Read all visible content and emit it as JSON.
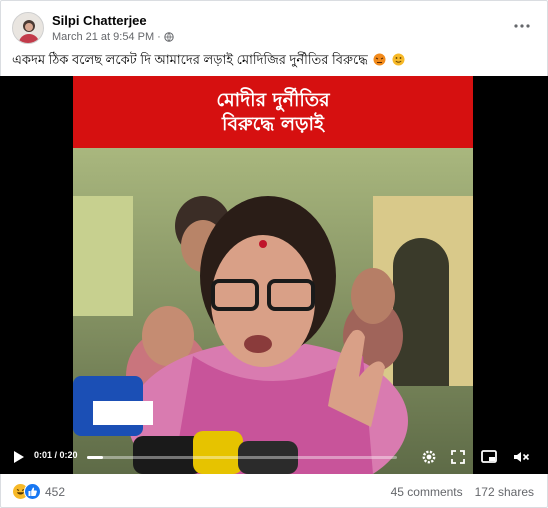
{
  "post": {
    "author": "Silpi Chatterjee",
    "timestamp": "March 21 at 9:54 PM",
    "separator": "·",
    "privacy_icon": "globe-icon",
    "more_icon": "more-options-icon",
    "caption": "একদম ঠিক বলেছ লকেট দি আমাদের লড়াই মোদিজির দুর্নীতির বিরুদ্ধে"
  },
  "video": {
    "banner_line1": "মোদীর দুর্নীতির",
    "banner_line2": "বিরুদ্ধে লড়াই",
    "time": "0:01 / 0:20",
    "progress": 0.05
  },
  "footer": {
    "reaction_count": "452",
    "comments": "45 comments",
    "shares": "172 shares"
  },
  "colors": {
    "banner_red": "#d61010",
    "like_blue": "#1877f2",
    "haha_yellow": "#f7b928",
    "muted_text": "#65676b"
  }
}
